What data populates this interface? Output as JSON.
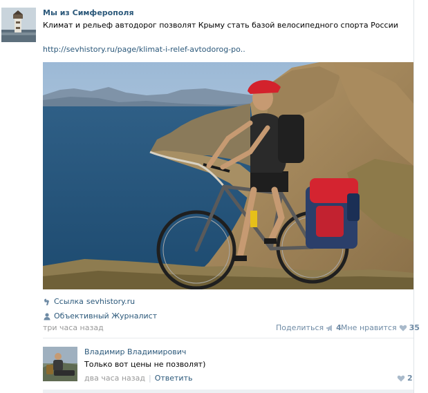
{
  "post": {
    "author": "Мы из Симферополя",
    "text": "Климат и рельеф автодорог позволят Крыму стать базой велосипедного спорта России",
    "link": "http://sevhistory.ru/page/klimat-i-relef-avtodorog-po..",
    "attachment_link_label": "Ссылка",
    "attachment_link_domain": "sevhistory.ru",
    "attachment_author": "Объективный Журналист",
    "time": "три часа назад",
    "share_label": "Поделиться",
    "share_count": "4",
    "like_label": "Мне нравится",
    "like_count": "35"
  },
  "comment": {
    "author": "Владимир Владимирович",
    "text": "Только вот цены не позволят)",
    "time": "два часа назад",
    "separator": "|",
    "reply_label": "Ответить",
    "like_count": "2"
  },
  "colors": {
    "link": "#2b587a",
    "muted": "#999999",
    "action": "#6f8ba5"
  },
  "icons": {
    "attachment_link": "link-icon",
    "attachment_author": "user-icon",
    "share": "megaphone-icon",
    "like": "heart-icon"
  }
}
